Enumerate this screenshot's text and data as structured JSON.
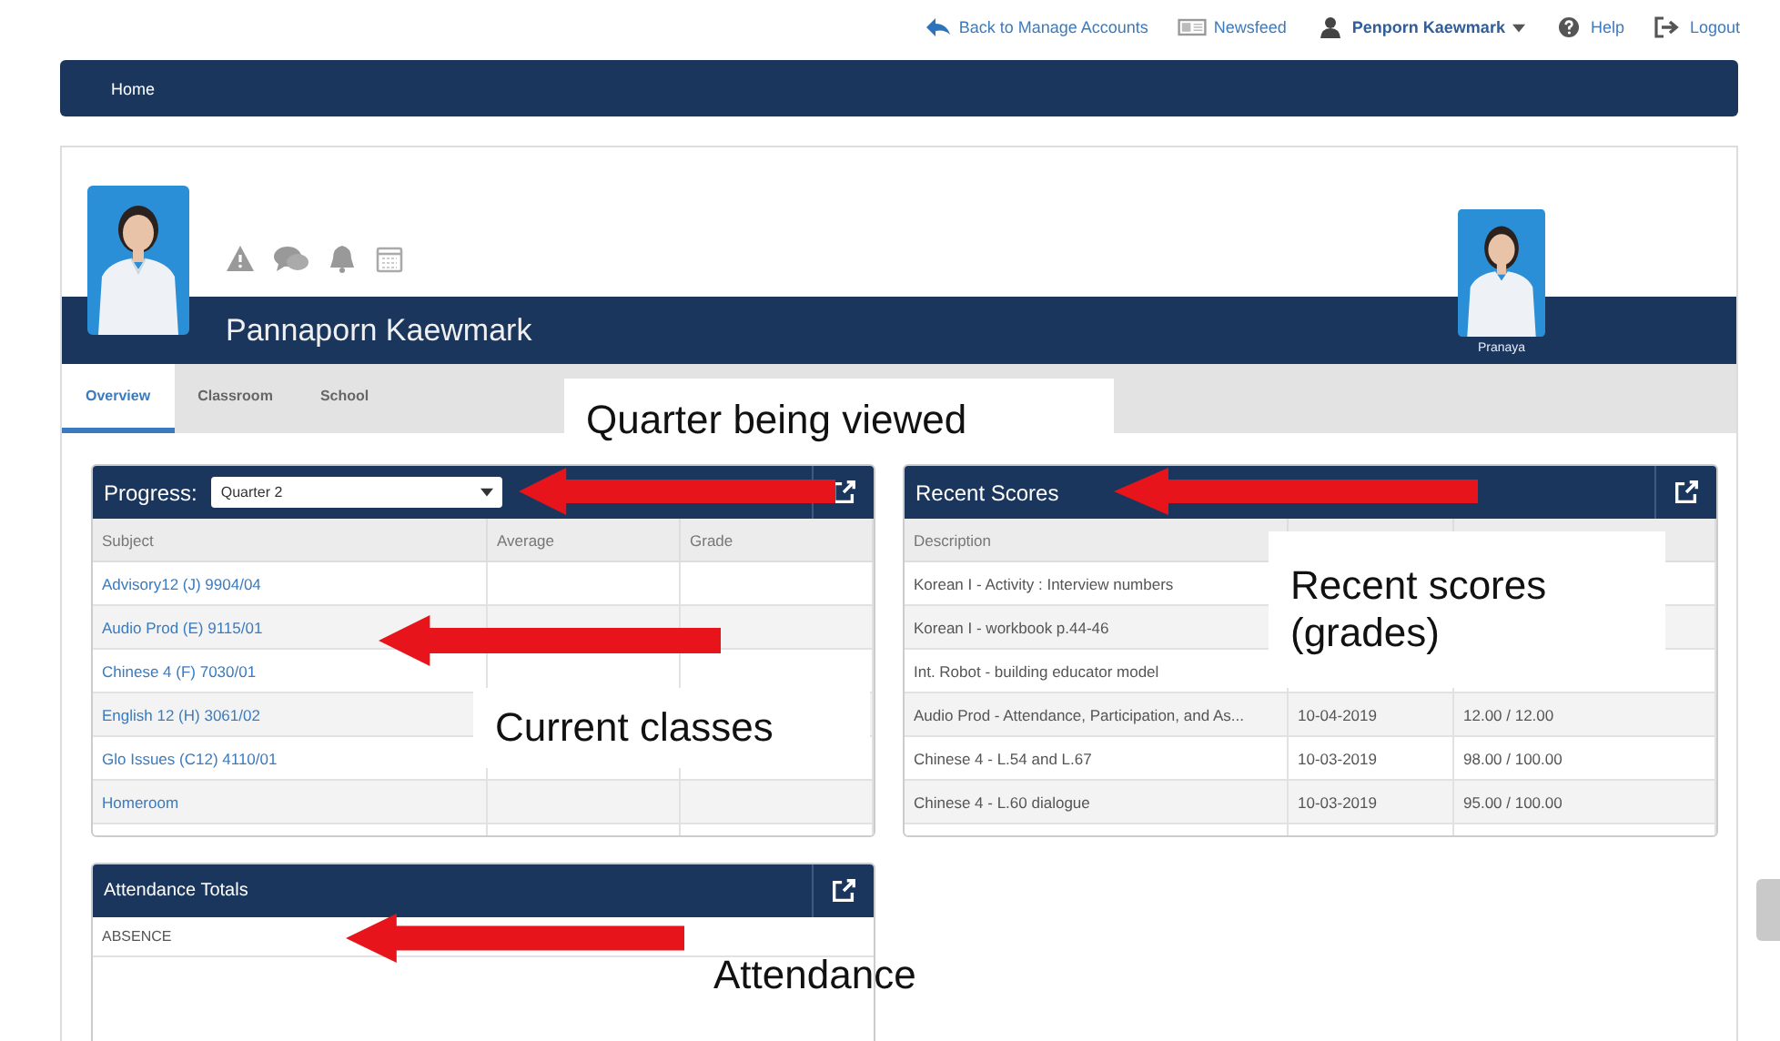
{
  "top_links": [
    {
      "kind": "back",
      "label": "Back to Manage Accounts"
    },
    {
      "kind": "newsfeed",
      "label": "Newsfeed"
    },
    {
      "kind": "user",
      "label": "Penporn Kaewmark"
    },
    {
      "kind": "help",
      "label": "Help"
    },
    {
      "kind": "logout",
      "label": "Logout"
    }
  ],
  "nav": {
    "items": [
      {
        "label": "Home"
      }
    ]
  },
  "profile": {
    "name": "Pannaporn Kaewmark",
    "alerts": [
      {
        "kind": "warning"
      },
      {
        "kind": "chat"
      },
      {
        "kind": "bell"
      },
      {
        "kind": "calendar"
      }
    ],
    "sibling": {
      "name": "Pranaya"
    }
  },
  "tabs": [
    {
      "label": "Overview",
      "selected": true
    },
    {
      "label": "Classroom",
      "selected": false
    },
    {
      "label": "School",
      "selected": false
    }
  ],
  "progress": {
    "title": "Progress:",
    "quarter": "Quarter 2",
    "columns": [
      "Subject",
      "Average",
      "Grade"
    ],
    "rows": [
      {
        "subject": "Advisory12 (J) 9904/04"
      },
      {
        "subject": "Audio Prod (E) 9115/01"
      },
      {
        "subject": "Chinese 4 (F) 7030/01"
      },
      {
        "subject": "English 12 (H) 3061/02"
      },
      {
        "subject": "Glo Issues (C12) 4110/01"
      },
      {
        "subject": "Homeroom"
      }
    ]
  },
  "recent_scores": {
    "title": "Recent Scores",
    "columns": [
      "Description"
    ],
    "rows": [
      {
        "description": "Korean I - Activity : Interview numbers"
      },
      {
        "description": "Korean I - workbook p.44-46"
      },
      {
        "description": "Int. Robot - building educator model"
      },
      {
        "description": "Audio Prod - Attendance, Participation, and As...",
        "date": "10-04-2019",
        "score": "12.00 / 12.00"
      },
      {
        "description": "Chinese 4 - L.54 and L.67",
        "date": "10-03-2019",
        "score": "98.00 / 100.00"
      },
      {
        "description": "Chinese 4 - L.60 dialogue",
        "date": "10-03-2019",
        "score": "95.00 / 100.00"
      }
    ]
  },
  "attendance": {
    "title": "Attendance Totals",
    "rows": [
      "ABSENCE"
    ]
  },
  "annotations": [
    {
      "text": "Quarter being viewed",
      "boxed": true
    },
    {
      "text": "Recent scores (grades)",
      "boxed": true
    },
    {
      "text": "Current classes",
      "boxed": true
    },
    {
      "text": "Attendance",
      "boxed": false
    }
  ]
}
